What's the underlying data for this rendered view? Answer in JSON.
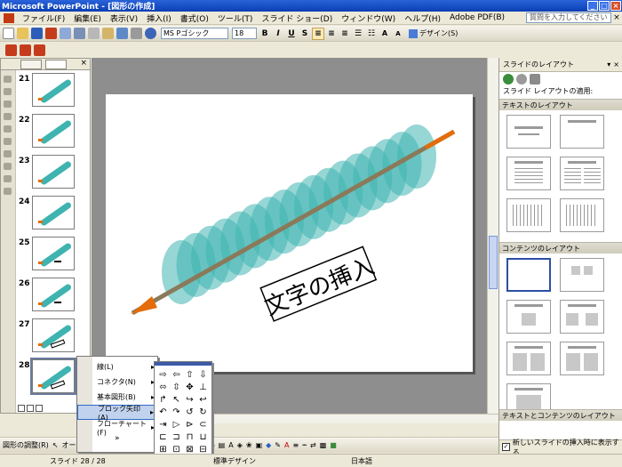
{
  "window": {
    "title": "Microsoft PowerPoint - [図形の作成]"
  },
  "menu": {
    "items": [
      "ファイル(F)",
      "編集(E)",
      "表示(V)",
      "挿入(I)",
      "書式(O)",
      "ツール(T)",
      "スライド ショー(D)",
      "ウィンドウ(W)",
      "ヘルプ(H)",
      "Adobe PDF(B)"
    ],
    "help_placeholder": "質問を入力してください"
  },
  "toolbar": {
    "font_name": "MS Pゴシック",
    "font_size": "18",
    "bold": "B",
    "italic": "I",
    "underline": "U",
    "shadow": "S",
    "design_label": "デザイン(S)"
  },
  "thumbnails": {
    "numbers": [
      "21",
      "22",
      "23",
      "24",
      "25",
      "26",
      "27",
      "28"
    ],
    "selected": "28"
  },
  "slide": {
    "label_text": "文字の挿入",
    "colors": {
      "ellipse": "#40b4b0",
      "arrow": "#e46c0a",
      "line": "#8a7a5a"
    }
  },
  "task_pane": {
    "title": "スライドのレイアウト",
    "apply_label": "スライド レイアウトの適用:",
    "section_text": "テキストのレイアウト",
    "section_content": "コンテンツのレイアウト",
    "section_text_content": "テキストとコンテンツのレイアウト",
    "footer_label": "新しいスライドの挿入時に表示する"
  },
  "draw_menu": {
    "items": [
      "線(L)",
      "コネクタ(N)",
      "基本図形(B)",
      "ブロック矢印(A)",
      "フローチャート(F)"
    ],
    "highlighted": "ブロック矢印(A)",
    "more": "»"
  },
  "block_arrows": [
    "⇨",
    "⇦",
    "⇧",
    "⇩",
    "⬄",
    "⇳",
    "✥",
    "⊥",
    "↱",
    "↖",
    "↪",
    "↩",
    "↶",
    "↷",
    "↺",
    "↻",
    "⇥",
    "▷",
    "⊳",
    "⊂",
    "⊏",
    "⊐",
    "⊓",
    "⊔",
    "⊞",
    "⊡",
    "⊠",
    "⊟"
  ],
  "draw_toolbar": {
    "adjust": "図形の調整(R)",
    "autoshape": "オートシェイプ(U)"
  },
  "status": {
    "slide_pos": "スライド 28 / 28",
    "design": "標準デザイン",
    "lang": "日本語"
  }
}
